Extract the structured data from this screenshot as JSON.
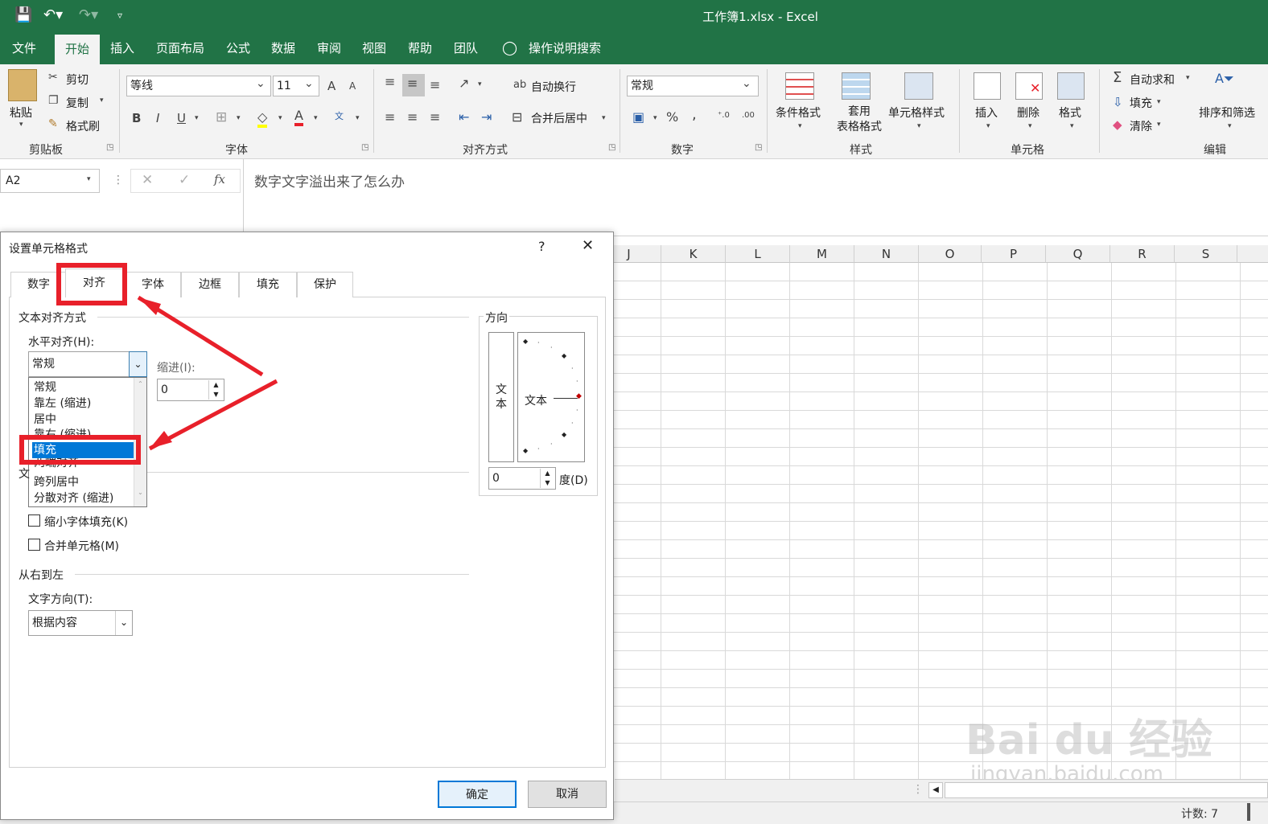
{
  "window": {
    "title": "工作簿1.xlsx  -  Excel"
  },
  "menu": {
    "tabs": [
      "文件",
      "开始",
      "插入",
      "页面布局",
      "公式",
      "数据",
      "审阅",
      "视图",
      "帮助",
      "团队"
    ],
    "tell_me": "操作说明搜索"
  },
  "ribbon": {
    "clipboard": {
      "paste": "粘贴",
      "cut": "剪切",
      "copy": "复制",
      "format_painter": "格式刷",
      "label": "剪贴板"
    },
    "font": {
      "name": "等线",
      "size": "11",
      "grow": "A",
      "shrink": "A",
      "bold": "B",
      "italic": "I",
      "underline": "U",
      "label": "字体"
    },
    "alignment": {
      "wrap": "自动换行",
      "merge": "合并后居中",
      "label": "对齐方式"
    },
    "number": {
      "format": "常规",
      "percent": "%",
      "comma": ",",
      "label": "数字"
    },
    "styles": {
      "conditional": "条件格式",
      "table": "套用\n表格格式",
      "cell": "单元格样式",
      "label": "样式"
    },
    "cells": {
      "insert": "插入",
      "delete": "删除",
      "format": "格式",
      "label": "单元格"
    },
    "editing": {
      "autosum": "自动求和",
      "fill": "填充",
      "clear": "清除",
      "sort": "排序和筛选",
      "label": "编辑"
    }
  },
  "formula_bar": {
    "name_box": "A2",
    "fx": "fx",
    "content": "数字文字溢出来了怎么办"
  },
  "grid": {
    "columns": [
      "J",
      "K",
      "L",
      "M",
      "N",
      "O",
      "P",
      "Q",
      "R",
      "S"
    ]
  },
  "status": {
    "count": "计数: 7"
  },
  "watermark": {
    "brand": "Bai du 经验",
    "url": "jingyan.baidu.com"
  },
  "dialog": {
    "title": "设置单元格格式",
    "help": "?",
    "close": "✕",
    "tabs": [
      "数字",
      "对齐",
      "字体",
      "边框",
      "填充",
      "保护"
    ],
    "text_align_section": "文本对齐方式",
    "horizontal_label": "水平对齐(H):",
    "horizontal_value": "常规",
    "indent_label": "缩进(I):",
    "indent_value": "0",
    "list_items": [
      "常规",
      "靠左 (缩进)",
      "居中",
      "靠右 (缩进)",
      "填充",
      "两端对齐",
      "跨列居中",
      "分散对齐 (缩进)"
    ],
    "text_control_partial": "文",
    "shrink_label": "缩小字体填充(K)",
    "merge_label": "合并单元格(M)",
    "rtl_section": "从右到左",
    "direction_label": "文字方向(T):",
    "direction_value": "根据内容",
    "orientation": {
      "label": "方向",
      "vertical_text": "文\n本",
      "text": "文本",
      "degrees": "0",
      "degree_label": "度(D)"
    },
    "ok": "确定",
    "cancel": "取消"
  }
}
